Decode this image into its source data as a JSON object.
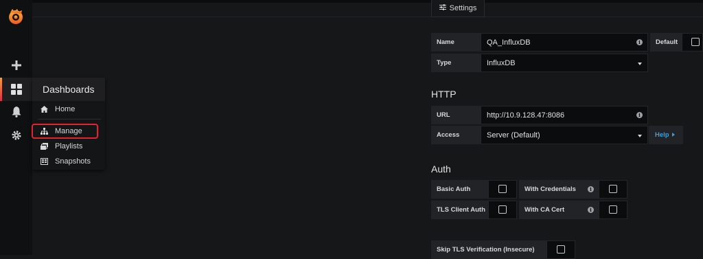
{
  "sidebar": {
    "icons": [
      "grafana-logo-icon",
      "plus-icon",
      "dashboards-grid-icon",
      "bell-icon",
      "gear-icon"
    ]
  },
  "menu": {
    "title": "Dashboards",
    "items": [
      {
        "label": "Home",
        "icon": "home-icon"
      },
      {
        "label": "Manage",
        "icon": "sitemap-icon"
      },
      {
        "label": "Playlists",
        "icon": "playlist-icon"
      },
      {
        "label": "Snapshots",
        "icon": "snapshot-icon"
      }
    ]
  },
  "tabs": {
    "settings": "Settings"
  },
  "form": {
    "name_label": "Name",
    "name_value": "QA_InfluxDB",
    "default_label": "Default",
    "type_label": "Type",
    "type_value": "InfluxDB"
  },
  "http": {
    "heading": "HTTP",
    "url_label": "URL",
    "url_value": "http://10.9.128.47:8086",
    "access_label": "Access",
    "access_value": "Server (Default)",
    "help_label": "Help"
  },
  "auth": {
    "heading": "Auth",
    "basic_auth": "Basic Auth",
    "with_credentials": "With Credentials",
    "tls_client_auth": "TLS Client Auth",
    "with_ca_cert": "With CA Cert",
    "skip_tls": "Skip TLS Verification (Insecure)"
  },
  "colors": {
    "accent_red": "#e8212f",
    "help_blue": "#33a2e5",
    "logo_orange": "#f29f3a"
  }
}
